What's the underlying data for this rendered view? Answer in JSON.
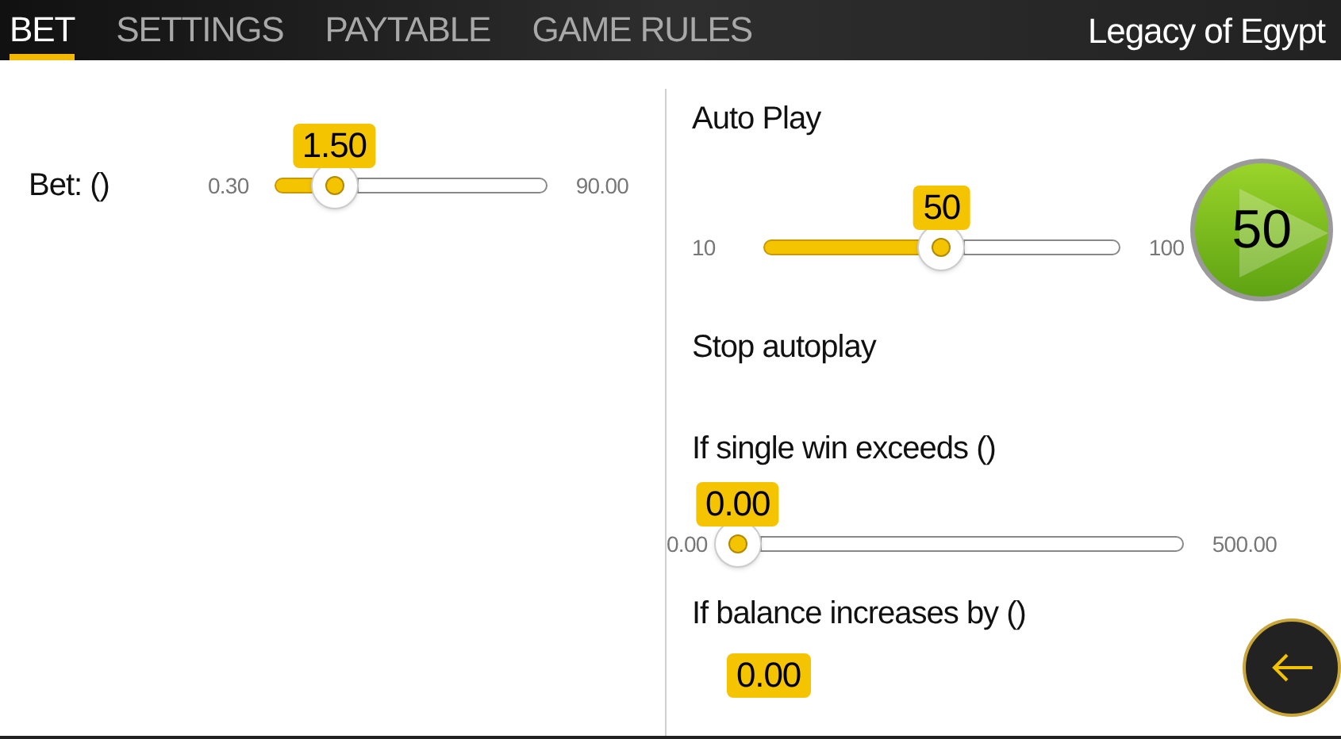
{
  "tabs": [
    {
      "label": "BET",
      "selected": true
    },
    {
      "label": "SETTINGS",
      "selected": false
    },
    {
      "label": "PAYTABLE",
      "selected": false
    },
    {
      "label": "GAME RULES",
      "selected": false
    }
  ],
  "game_title": "Legacy of Egypt",
  "bet": {
    "label": "Bet: ()",
    "value": "1.50",
    "min": "0.30",
    "max": "90.00",
    "level": 0.22
  },
  "auto_play": {
    "title": "Auto Play",
    "value": "50",
    "min": "10",
    "max": "100",
    "level": 0.5,
    "button_label": "50"
  },
  "stop_autoplay": {
    "title": "Stop autoplay",
    "items": [
      {
        "kind": "slider",
        "label": "If single win exceeds ()",
        "value": "0.00",
        "min": "0.00",
        "max": "500.00"
      },
      {
        "kind": "value",
        "label": "If balance increases by ()",
        "value": "0.00"
      }
    ]
  }
}
